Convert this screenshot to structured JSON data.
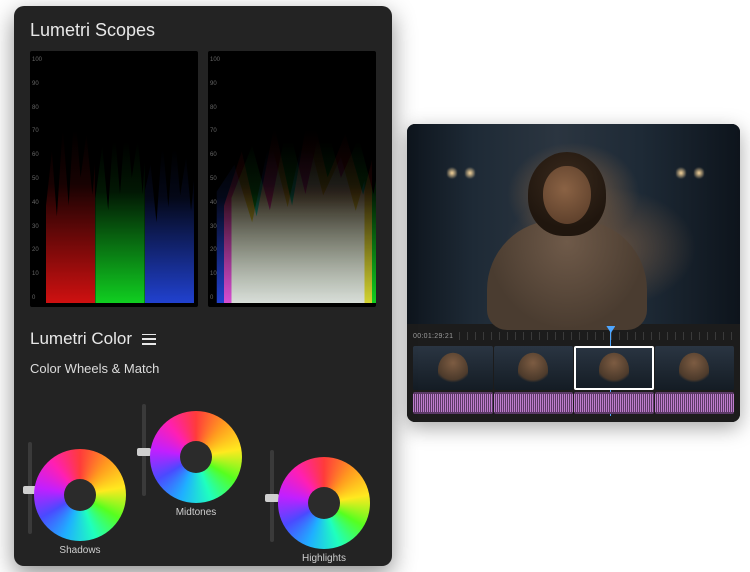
{
  "scopes_panel": {
    "title": "Lumetri Scopes",
    "scale_labels": [
      "100",
      "90",
      "80",
      "70",
      "60",
      "50",
      "40",
      "30",
      "20",
      "10",
      "0"
    ]
  },
  "color_panel": {
    "title": "Lumetri Color",
    "menu_icon": "menu-icon",
    "subtitle": "Color Wheels & Match",
    "wheels": {
      "shadows": {
        "label": "Shadows"
      },
      "midtones": {
        "label": "Midtones"
      },
      "highlights": {
        "label": "Highlights"
      }
    }
  },
  "timeline": {
    "timecode": "00:01:29:21",
    "clips": [
      {
        "id": "clip-1",
        "selected": false
      },
      {
        "id": "clip-2",
        "selected": false
      },
      {
        "id": "clip-3",
        "selected": true
      },
      {
        "id": "clip-4",
        "selected": false
      }
    ],
    "audio_clips": [
      {
        "id": "a1"
      },
      {
        "id": "a2"
      },
      {
        "id": "a3"
      },
      {
        "id": "a4"
      }
    ]
  }
}
